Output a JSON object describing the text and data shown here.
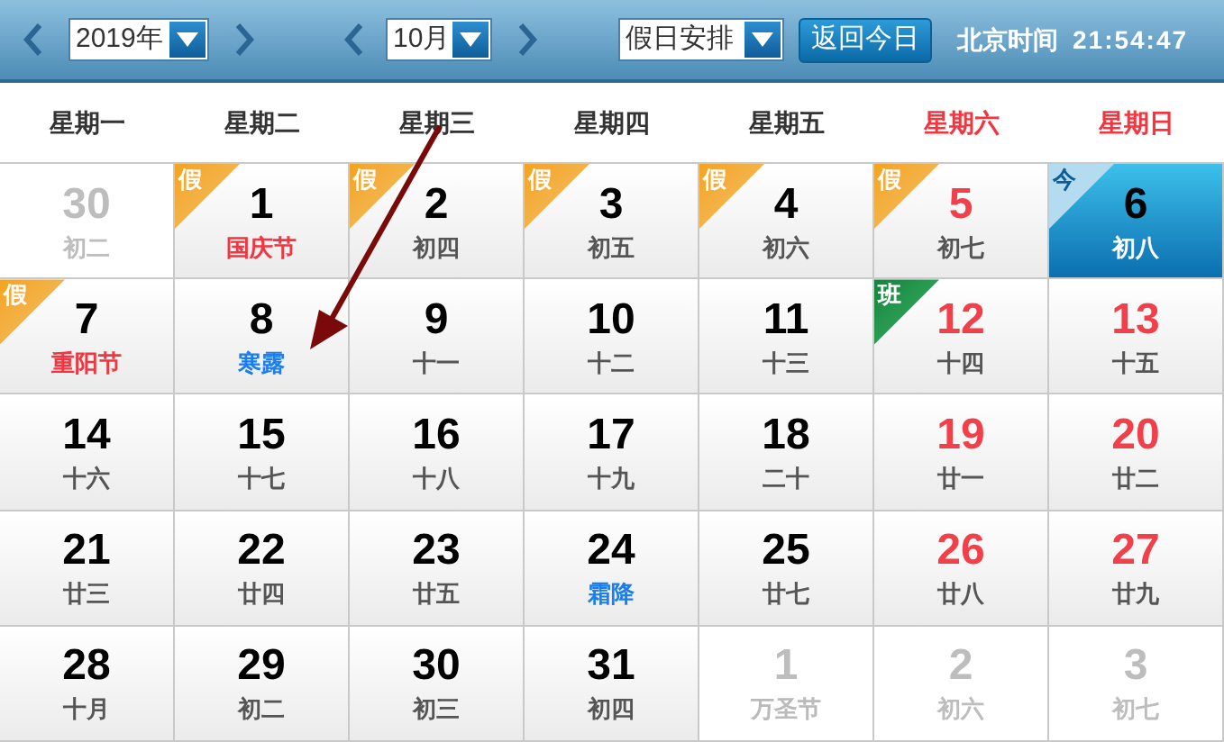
{
  "toolbar": {
    "year": "2019年",
    "month": "10月",
    "mode": "假日安排",
    "today_button": "返回今日",
    "clock_label": "北京时间",
    "clock": "21:54:47"
  },
  "weekdays": [
    {
      "label": "星期一",
      "weekend": false
    },
    {
      "label": "星期二",
      "weekend": false
    },
    {
      "label": "星期三",
      "weekend": false
    },
    {
      "label": "星期四",
      "weekend": false
    },
    {
      "label": "星期五",
      "weekend": false
    },
    {
      "label": "星期六",
      "weekend": true
    },
    {
      "label": "星期日",
      "weekend": true
    }
  ],
  "days": [
    {
      "day": "30",
      "lunar": "初二",
      "in_month": false,
      "kind": "normal",
      "selected": false
    },
    {
      "day": "1",
      "lunar": "国庆节",
      "in_month": true,
      "kind": "festival",
      "badge": {
        "text": "假",
        "kind": "holiday"
      },
      "selected": false
    },
    {
      "day": "2",
      "lunar": "初四",
      "in_month": true,
      "kind": "normal",
      "badge": {
        "text": "假",
        "kind": "holiday"
      },
      "selected": false
    },
    {
      "day": "3",
      "lunar": "初五",
      "in_month": true,
      "kind": "normal",
      "badge": {
        "text": "假",
        "kind": "holiday"
      },
      "selected": false
    },
    {
      "day": "4",
      "lunar": "初六",
      "in_month": true,
      "kind": "normal",
      "badge": {
        "text": "假",
        "kind": "holiday"
      },
      "selected": false
    },
    {
      "day": "5",
      "lunar": "初七",
      "in_month": true,
      "kind": "normal",
      "badge": {
        "text": "假",
        "kind": "holiday"
      },
      "selected": false
    },
    {
      "day": "6",
      "lunar": "初八",
      "in_month": true,
      "kind": "normal",
      "badge": {
        "text": "今",
        "kind": "today"
      },
      "selected": true
    },
    {
      "day": "7",
      "lunar": "重阳节",
      "in_month": true,
      "kind": "festival",
      "badge": {
        "text": "假",
        "kind": "holiday"
      },
      "selected": false
    },
    {
      "day": "8",
      "lunar": "寒露",
      "in_month": true,
      "kind": "solar_term",
      "selected": false
    },
    {
      "day": "9",
      "lunar": "十一",
      "in_month": true,
      "kind": "normal",
      "selected": false
    },
    {
      "day": "10",
      "lunar": "十二",
      "in_month": true,
      "kind": "normal",
      "selected": false
    },
    {
      "day": "11",
      "lunar": "十三",
      "in_month": true,
      "kind": "normal",
      "selected": false
    },
    {
      "day": "12",
      "lunar": "十四",
      "in_month": true,
      "kind": "normal",
      "badge": {
        "text": "班",
        "kind": "workday"
      },
      "selected": false
    },
    {
      "day": "13",
      "lunar": "十五",
      "in_month": true,
      "kind": "normal",
      "selected": false
    },
    {
      "day": "14",
      "lunar": "十六",
      "in_month": true,
      "kind": "normal",
      "selected": false
    },
    {
      "day": "15",
      "lunar": "十七",
      "in_month": true,
      "kind": "normal",
      "selected": false
    },
    {
      "day": "16",
      "lunar": "十八",
      "in_month": true,
      "kind": "normal",
      "selected": false
    },
    {
      "day": "17",
      "lunar": "十九",
      "in_month": true,
      "kind": "normal",
      "selected": false
    },
    {
      "day": "18",
      "lunar": "二十",
      "in_month": true,
      "kind": "normal",
      "selected": false
    },
    {
      "day": "19",
      "lunar": "廿一",
      "in_month": true,
      "kind": "normal",
      "selected": false
    },
    {
      "day": "20",
      "lunar": "廿二",
      "in_month": true,
      "kind": "normal",
      "selected": false
    },
    {
      "day": "21",
      "lunar": "廿三",
      "in_month": true,
      "kind": "normal",
      "selected": false
    },
    {
      "day": "22",
      "lunar": "廿四",
      "in_month": true,
      "kind": "normal",
      "selected": false
    },
    {
      "day": "23",
      "lunar": "廿五",
      "in_month": true,
      "kind": "normal",
      "selected": false
    },
    {
      "day": "24",
      "lunar": "霜降",
      "in_month": true,
      "kind": "solar_term",
      "selected": false
    },
    {
      "day": "25",
      "lunar": "廿七",
      "in_month": true,
      "kind": "normal",
      "selected": false
    },
    {
      "day": "26",
      "lunar": "廿八",
      "in_month": true,
      "kind": "normal",
      "selected": false
    },
    {
      "day": "27",
      "lunar": "廿九",
      "in_month": true,
      "kind": "normal",
      "selected": false
    },
    {
      "day": "28",
      "lunar": "十月",
      "in_month": true,
      "kind": "normal",
      "selected": false
    },
    {
      "day": "29",
      "lunar": "初二",
      "in_month": true,
      "kind": "normal",
      "selected": false
    },
    {
      "day": "30",
      "lunar": "初三",
      "in_month": true,
      "kind": "normal",
      "selected": false
    },
    {
      "day": "31",
      "lunar": "初四",
      "in_month": true,
      "kind": "normal",
      "selected": false
    },
    {
      "day": "1",
      "lunar": "万圣节",
      "in_month": false,
      "kind": "festival",
      "selected": false
    },
    {
      "day": "2",
      "lunar": "初六",
      "in_month": false,
      "kind": "normal",
      "selected": false
    },
    {
      "day": "3",
      "lunar": "初七",
      "in_month": false,
      "kind": "normal",
      "selected": false
    }
  ]
}
